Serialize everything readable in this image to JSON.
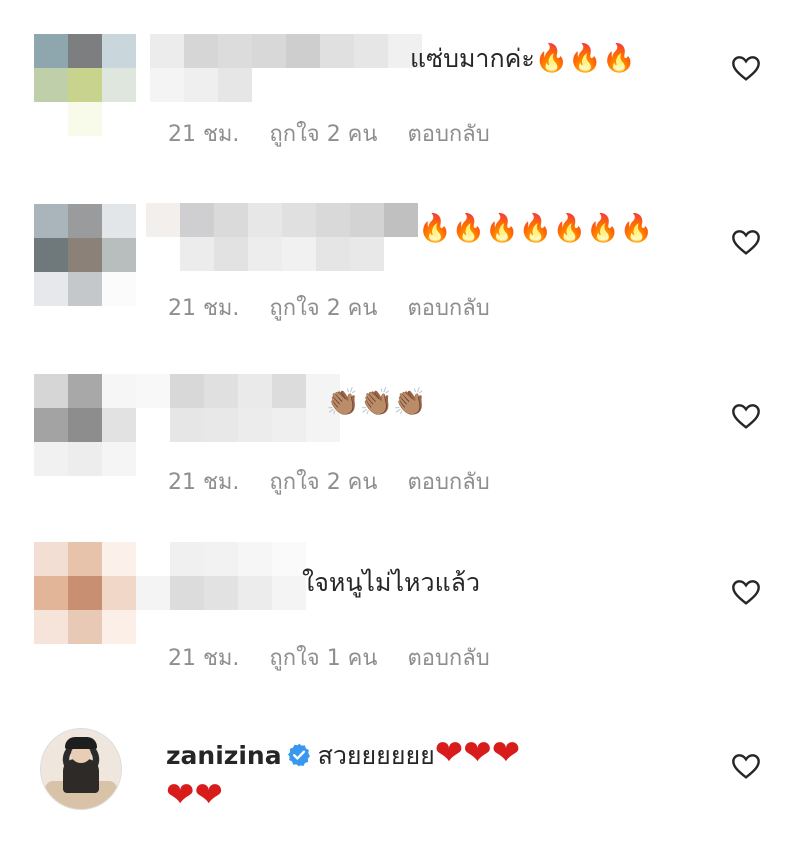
{
  "comments": [
    {
      "username": "",
      "text": "แซ่บมากค่ะ",
      "emojis": "🔥🔥🔥",
      "time": "21 ชม.",
      "likes": "ถูกใจ 2 คน",
      "reply": "ตอบกลับ"
    },
    {
      "username": "",
      "text": "",
      "emojis": "🔥🔥🔥🔥🔥🔥🔥",
      "time": "21 ชม.",
      "likes": "ถูกใจ 2 คน",
      "reply": "ตอบกลับ"
    },
    {
      "username": "",
      "text": "",
      "emojis": "👏🏽👏🏽👏🏽",
      "time": "21 ชม.",
      "likes": "ถูกใจ 2 คน",
      "reply": "ตอบกลับ"
    },
    {
      "username": "",
      "text": "ใจหนูไม่ไหวแล้ว",
      "emojis": "",
      "time": "21 ชม.",
      "likes": "ถูกใจ 1 คน",
      "reply": "ตอบกลับ"
    },
    {
      "username": "zanizina",
      "verified": true,
      "text": "สวยยยยยย",
      "emojis": "❤❤❤",
      "emojis_line2": "❤❤"
    }
  ],
  "icons": {
    "like": "heart-outline-icon",
    "verified": "verified-badge-icon"
  },
  "colors": {
    "text": "#262626",
    "meta": "#8e8e8e",
    "verified": "#3897f0",
    "red_heart": "#d81b1b"
  }
}
